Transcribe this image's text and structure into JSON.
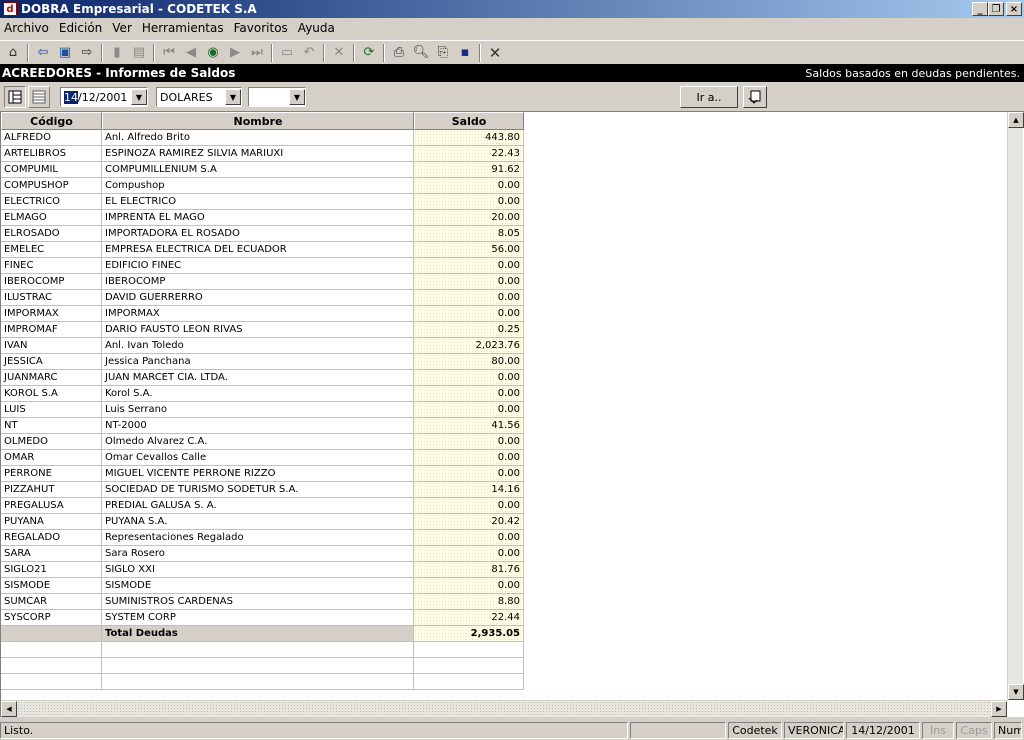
{
  "window": {
    "title": "DOBRA Empresarial - CODETEK S.A",
    "buttons": [
      "_",
      "❐",
      "×"
    ]
  },
  "menu": [
    "Archivo",
    "Edición",
    "Ver",
    "Herramientas",
    "Favoritos",
    "Ayuda"
  ],
  "header": {
    "title": "ACREEDORES - Informes de Saldos",
    "subtitle": "Saldos basados en deudas pendientes."
  },
  "filters": {
    "date_selected": "14",
    "date_rest": "/12/2001",
    "currency": "DOLARES",
    "third": "",
    "goto_label": "Ir a.."
  },
  "table": {
    "columns": [
      "Código",
      "Nombre",
      "Saldo"
    ],
    "rows": [
      [
        "ALFREDO",
        "Anl. Alfredo Brito",
        "443.80"
      ],
      [
        "ARTELIBROS",
        "ESPINOZA RAMIREZ SILVIA MARIUXI",
        "22.43"
      ],
      [
        "COMPUMIL",
        "COMPUMILLENIUM S.A",
        "91.62"
      ],
      [
        "COMPUSHOP",
        "Compushop",
        "0.00"
      ],
      [
        "ELECTRICO",
        "EL ELECTRICO",
        "0.00"
      ],
      [
        "ELMAGO",
        "IMPRENTA EL MAGO",
        "20.00"
      ],
      [
        "ELROSADO",
        "IMPORTADORA EL ROSADO",
        "8.05"
      ],
      [
        "EMELEC",
        "EMPRESA ELECTRICA DEL ECUADOR",
        "56.00"
      ],
      [
        "FINEC",
        "EDIFICIO FINEC",
        "0.00"
      ],
      [
        "IBEROCOMP",
        "IBEROCOMP",
        "0.00"
      ],
      [
        "ILUSTRAC",
        "DAVID GUERRERRO",
        "0.00"
      ],
      [
        "IMPORMAX",
        "IMPORMAX",
        "0.00"
      ],
      [
        "IMPROMAF",
        "DARIO FAUSTO LEON RIVAS",
        "0.25"
      ],
      [
        "IVAN",
        "Anl. Ivan Toledo",
        "2,023.76"
      ],
      [
        "JESSICA",
        "Jessica Panchana",
        "80.00"
      ],
      [
        "JUANMARC",
        "JUAN MARCET CIA. LTDA.",
        "0.00"
      ],
      [
        "KOROL S.A",
        "Korol S.A.",
        "0.00"
      ],
      [
        "LUIS",
        "Luis Serrano",
        "0.00"
      ],
      [
        "NT",
        "NT-2000",
        "41.56"
      ],
      [
        "OLMEDO",
        "Olmedo Alvarez C.A.",
        "0.00"
      ],
      [
        "OMAR",
        "Omar Cevallos Calle",
        "0.00"
      ],
      [
        "PERRONE",
        "MIGUEL VICENTE PERRONE RIZZO",
        "0.00"
      ],
      [
        "PIZZAHUT",
        "SOCIEDAD DE TURISMO SODETUR S.A.",
        "14.16"
      ],
      [
        "PREGALUSA",
        "PREDIAL GALUSA S. A.",
        "0.00"
      ],
      [
        "PUYANA",
        "PUYANA S.A.",
        "20.42"
      ],
      [
        "REGALADO",
        "Representaciones Regalado",
        "0.00"
      ],
      [
        "SARA",
        "Sara Rosero",
        "0.00"
      ],
      [
        "SIGLO21",
        "SIGLO XXI",
        "81.76"
      ],
      [
        "SISMODE",
        "SISMODE",
        "0.00"
      ],
      [
        "SUMCAR",
        "SUMINISTROS CARDENAS",
        "8.80"
      ],
      [
        "SYSCORP",
        "SYSTEM CORP",
        "22.44"
      ]
    ],
    "total": {
      "label": "Total Deudas",
      "value": "2,935.05"
    }
  },
  "status": {
    "message": "Listo.",
    "company": "Codetek",
    "user": "VERONICA",
    "date": "14/12/2001",
    "ins": "Ins",
    "caps": "Caps",
    "num": "Num"
  }
}
